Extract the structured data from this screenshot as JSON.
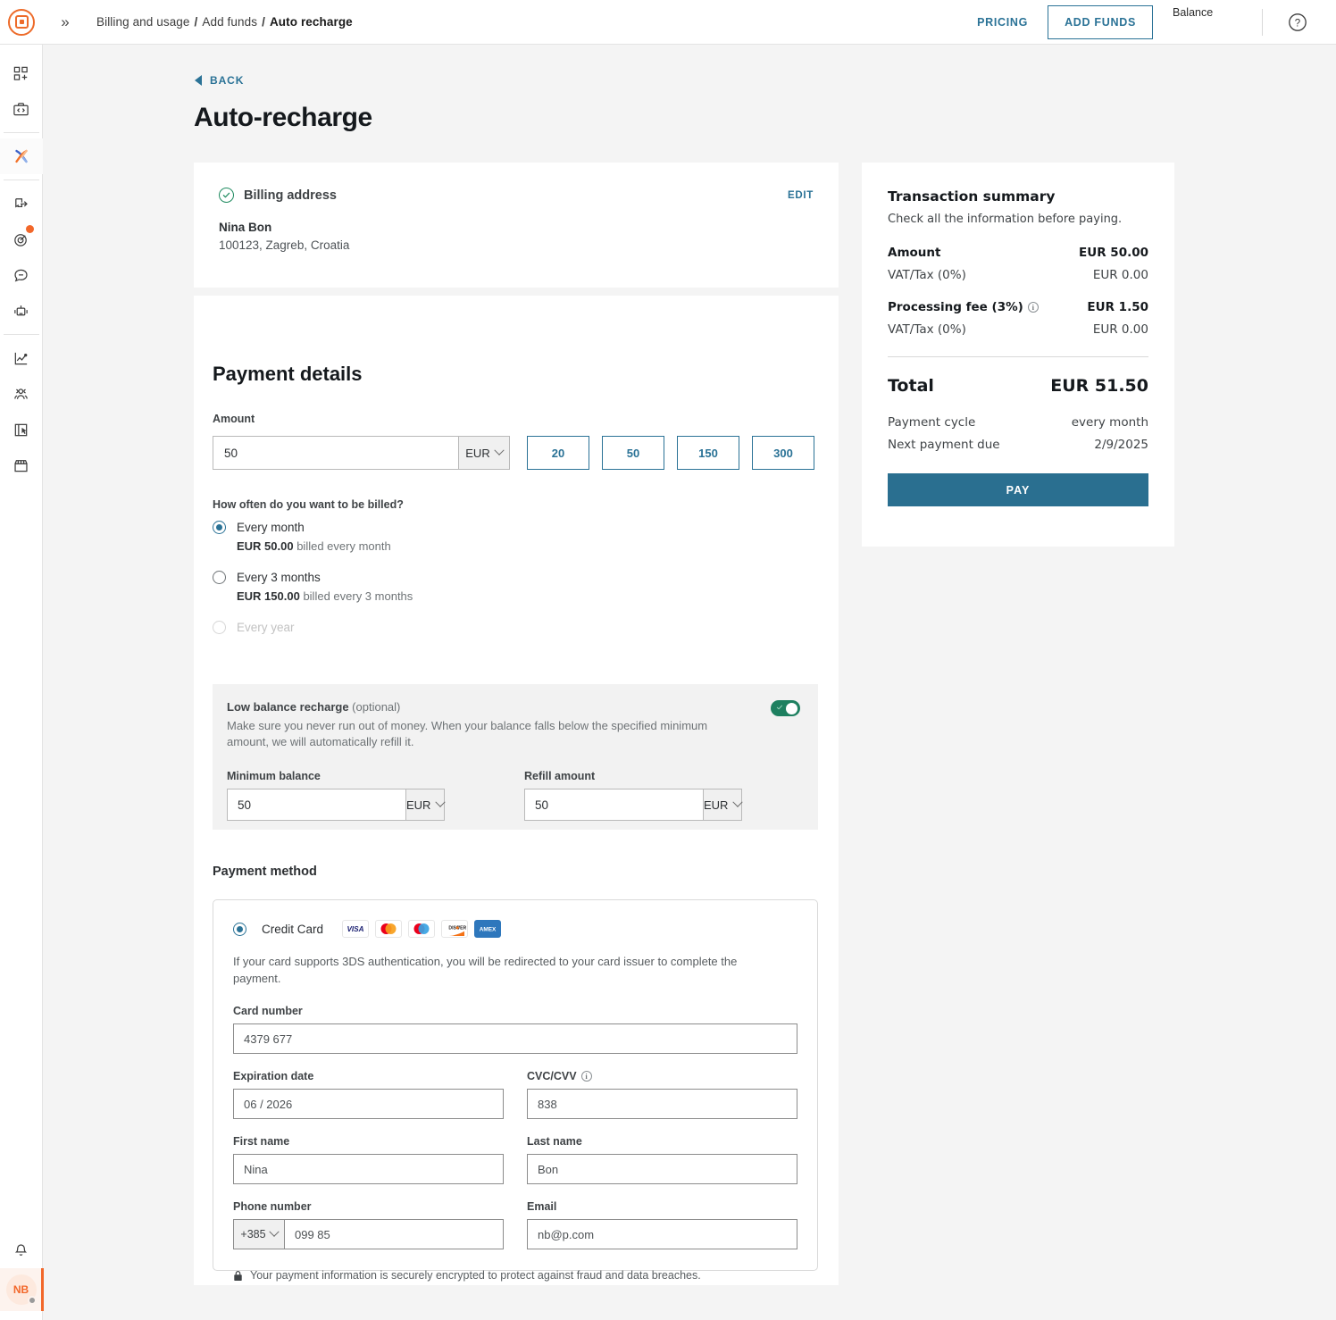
{
  "topbar": {
    "logo_icon": "brand-logo-icon",
    "expand_icon": "expand-sidebar-icon",
    "breadcrumb": [
      "Billing and usage",
      "Add funds",
      "Auto recharge"
    ],
    "breadcrumb_separator": "/",
    "pricing_label": "PRICING",
    "add_funds_label": "ADD FUNDS",
    "balance_label": "Balance",
    "help_icon": "help-question-icon"
  },
  "rail": {
    "items": [
      {
        "name": "apps-add-icon",
        "badge": false
      },
      {
        "name": "code-briefcase-icon",
        "badge": false
      },
      {
        "name": "x-brand-icon",
        "badge": false,
        "active": true
      },
      {
        "name": "export-icon",
        "badge": false
      },
      {
        "name": "target-icon",
        "badge": true
      },
      {
        "name": "chat-bubble-icon",
        "badge": false
      },
      {
        "name": "robot-icon",
        "badge": false
      },
      {
        "name": "analytics-chart-icon",
        "badge": false
      },
      {
        "name": "audience-icon",
        "badge": false
      },
      {
        "name": "click-report-icon",
        "badge": false
      },
      {
        "name": "storefront-icon",
        "badge": false
      }
    ],
    "notification_icon": "bell-icon",
    "avatar_initials": "NB"
  },
  "page": {
    "back_label": "BACK",
    "title": "Auto-recharge"
  },
  "billing": {
    "status_icon": "check-circle-icon",
    "title": "Billing address",
    "edit_label": "EDIT",
    "name": "Nina Bon",
    "address": "100123, Zagreb, Croatia"
  },
  "payment_details": {
    "section_title": "Payment details",
    "amount_label": "Amount",
    "amount_value": "50",
    "amount_currency": "EUR",
    "presets": [
      "20",
      "50",
      "150",
      "300"
    ],
    "frequency_question": "How often do you want to be billed?",
    "frequency_options": [
      {
        "label": "Every month",
        "sub_amount": "EUR 50.00",
        "sub_text": " billed every month",
        "selected": true,
        "disabled": false
      },
      {
        "label": "Every 3 months",
        "sub_amount": "EUR 150.00",
        "sub_text": " billed every 3 months",
        "selected": false,
        "disabled": false
      },
      {
        "label": "Every year",
        "sub_amount": "",
        "sub_text": "",
        "selected": false,
        "disabled": true
      }
    ]
  },
  "low_balance": {
    "title": "Low balance recharge",
    "optional_suffix": " (optional)",
    "description": "Make sure you never run out of money. When your balance falls below the specified minimum amount, we will automatically refill it.",
    "toggle_on": true,
    "min_balance_label": "Minimum balance",
    "min_balance_value": "50",
    "min_balance_currency": "EUR",
    "refill_label": "Refill amount",
    "refill_value": "50",
    "refill_currency": "EUR"
  },
  "payment_method": {
    "section_title": "Payment method",
    "option_label": "Credit Card",
    "card_brands": [
      "VISA",
      "Mastercard",
      "Maestro",
      "DISCOVER",
      "AMEX"
    ],
    "note": "If your card supports 3DS authentication, you will be redirected to your card issuer to complete the payment.",
    "card_number_label": "Card number",
    "card_number_value": "4379 677",
    "expiration_label": "Expiration date",
    "expiration_value": "06 / 2026",
    "cvc_label": "CVC/CVV",
    "cvc_value": "838",
    "first_name_label": "First name",
    "first_name_value": "Nina",
    "last_name_label": "Last name",
    "last_name_value": "Bon",
    "phone_label": "Phone number",
    "phone_country_code": "+385",
    "phone_value": "099 85",
    "email_label": "Email",
    "email_value": "nb@p.com",
    "secure_note": "Your payment information is securely encrypted to protect against fraud and data breaches.",
    "lock_icon": "lock-icon"
  },
  "summary": {
    "title": "Transaction summary",
    "subtitle": "Check all the information before paying.",
    "rows": [
      {
        "label": "Amount",
        "value": "EUR 50.00",
        "bold": true
      },
      {
        "label": "VAT/Tax (0%)",
        "value": "EUR 0.00",
        "bold": false
      },
      {
        "label": "Processing fee (3%)",
        "value": "EUR 1.50",
        "bold": true,
        "info": true
      },
      {
        "label": "VAT/Tax (0%)",
        "value": "EUR 0.00",
        "bold": false
      }
    ],
    "total_label": "Total",
    "total_value": "EUR 51.50",
    "cycle_label": "Payment cycle",
    "cycle_value": "every month",
    "next_due_label": "Next payment due",
    "next_due_value": "2/9/2025",
    "pay_label": "PAY"
  },
  "colors": {
    "accent_blue": "#2a7296",
    "brand_orange": "#f2672a",
    "toggle_green": "#1e8060",
    "pay_button": "#2a6f90"
  }
}
